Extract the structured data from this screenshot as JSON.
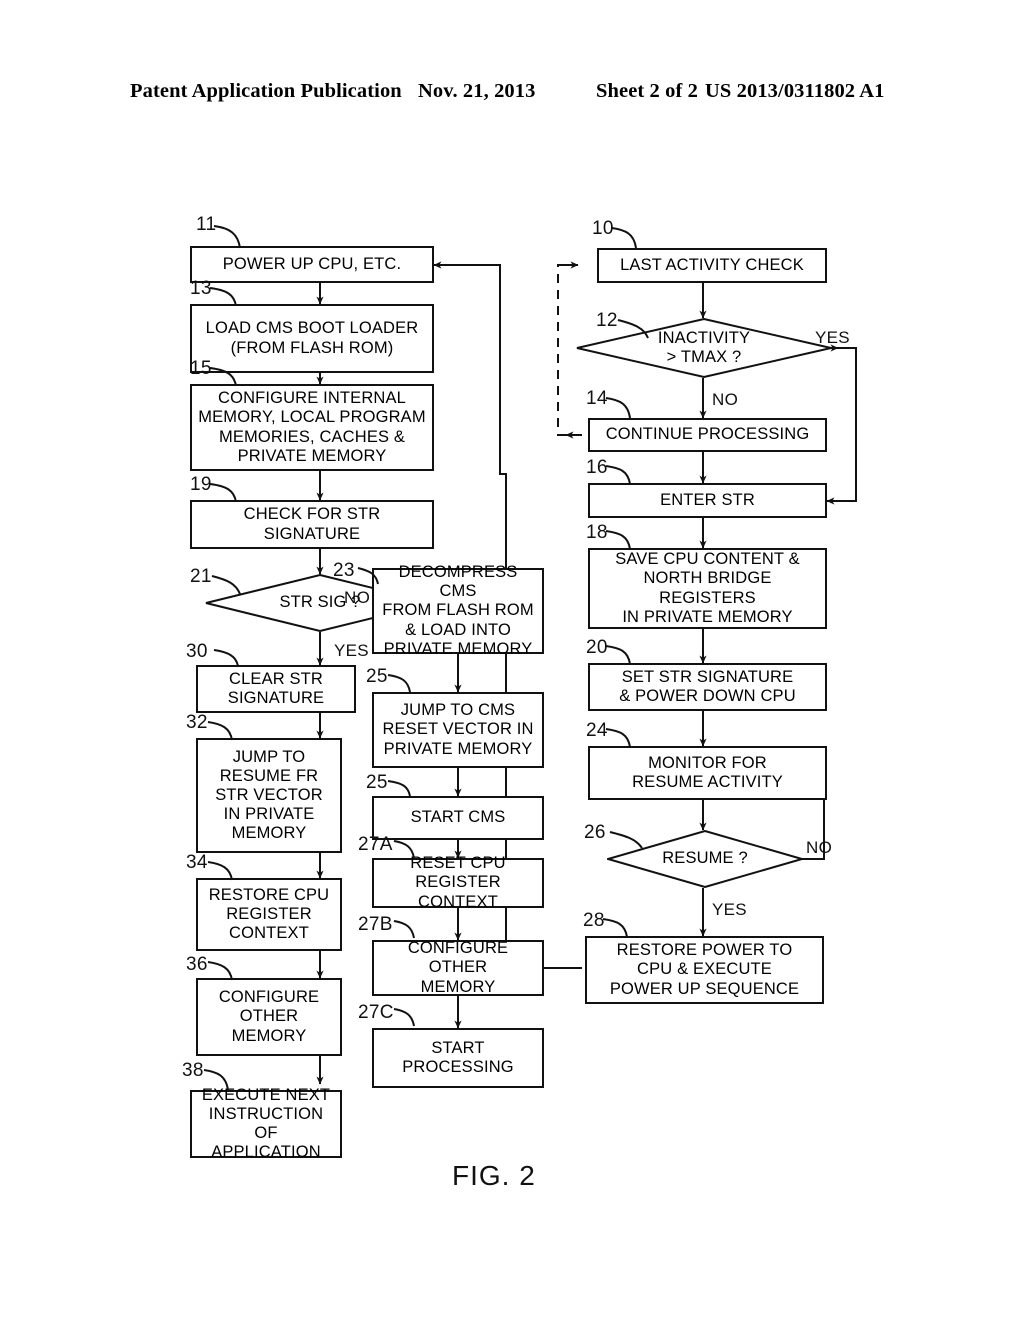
{
  "header": {
    "publication": "Patent Application Publication",
    "date": "Nov. 21, 2013",
    "sheet": "Sheet 2 of 2",
    "number": "US 2013/0311802 A1"
  },
  "figure": {
    "caption": "FIG. 2"
  },
  "chart_data": {
    "type": "diagram",
    "title": "FIG. 2",
    "nodes": [
      {
        "ref": "11",
        "kind": "process",
        "text": "POWER UP CPU, ETC."
      },
      {
        "ref": "13",
        "kind": "process",
        "text": "LOAD CMS BOOT LOADER\n(FROM FLASH ROM)"
      },
      {
        "ref": "15",
        "kind": "process",
        "text": "CONFIGURE INTERNAL\nMEMORY, LOCAL PROGRAM\nMEMORIES, CACHES &\nPRIVATE MEMORY"
      },
      {
        "ref": "19",
        "kind": "process",
        "text": "CHECK FOR STR\nSIGNATURE"
      },
      {
        "ref": "21",
        "kind": "decision",
        "text": "STR SIG ?"
      },
      {
        "ref": "30",
        "kind": "process",
        "text": "CLEAR STR\nSIGNATURE"
      },
      {
        "ref": "32",
        "kind": "process",
        "text": "JUMP TO\nRESUME FR\nSTR VECTOR\nIN PRIVATE\nMEMORY"
      },
      {
        "ref": "34",
        "kind": "process",
        "text": "RESTORE CPU\nREGISTER\nCONTEXT"
      },
      {
        "ref": "36",
        "kind": "process",
        "text": "CONFIGURE\nOTHER\nMEMORY"
      },
      {
        "ref": "38",
        "kind": "process",
        "text": "EXECUTE NEXT\nINSTRUCTION OF\nAPPLICATION"
      },
      {
        "ref": "23",
        "kind": "process",
        "text": "DECOMPRESS CMS\nFROM FLASH ROM\n& LOAD INTO\nPRIVATE MEMORY"
      },
      {
        "ref": "25",
        "kind": "process",
        "text": "JUMP TO CMS\nRESET VECTOR IN\nPRIVATE MEMORY"
      },
      {
        "ref": "25b",
        "kind": "process",
        "text": "START CMS"
      },
      {
        "ref": "27A",
        "kind": "process",
        "text": "RESET CPU\nREGISTER CONTEXT"
      },
      {
        "ref": "27B",
        "kind": "process",
        "text": "CONFIGURE OTHER\nMEMORY"
      },
      {
        "ref": "27C",
        "kind": "process",
        "text": "START\nPROCESSING"
      },
      {
        "ref": "10",
        "kind": "process",
        "text": "LAST ACTIVITY CHECK"
      },
      {
        "ref": "12",
        "kind": "decision",
        "text": "INACTIVITY\n> TMAX ?"
      },
      {
        "ref": "14",
        "kind": "process",
        "text": "CONTINUE PROCESSING"
      },
      {
        "ref": "16",
        "kind": "process",
        "text": "ENTER STR"
      },
      {
        "ref": "18",
        "kind": "process",
        "text": "SAVE CPU CONTENT &\nNORTH BRIDGE REGISTERS\nIN PRIVATE MEMORY"
      },
      {
        "ref": "20",
        "kind": "process",
        "text": "SET STR SIGNATURE\n& POWER DOWN CPU"
      },
      {
        "ref": "24",
        "kind": "process",
        "text": "MONITOR FOR\nRESUME ACTIVITY"
      },
      {
        "ref": "26",
        "kind": "decision",
        "text": "RESUME ?"
      },
      {
        "ref": "28",
        "kind": "process",
        "text": "RESTORE POWER TO\nCPU & EXECUTE\nPOWER UP  SEQUENCE"
      }
    ],
    "branch_labels": [
      {
        "id": "str-sig-no",
        "text": "NO"
      },
      {
        "id": "str-sig-yes",
        "text": "YES"
      },
      {
        "id": "inactivity-yes",
        "text": "YES"
      },
      {
        "id": "inactivity-no",
        "text": "NO"
      },
      {
        "id": "resume-no",
        "text": "NO"
      },
      {
        "id": "resume-yes",
        "text": "YES"
      }
    ],
    "ref_labels": [
      "11",
      "13",
      "15",
      "19",
      "21",
      "30",
      "32",
      "34",
      "36",
      "38",
      "23",
      "25",
      "25",
      "27A",
      "27B",
      "27C",
      "10",
      "12",
      "14",
      "16",
      "18",
      "20",
      "24",
      "26",
      "28"
    ]
  },
  "boxes": {
    "n11": "POWER UP CPU, ETC.",
    "n13": "LOAD CMS BOOT LOADER\n(FROM FLASH ROM)",
    "n15": "CONFIGURE INTERNAL\nMEMORY, LOCAL PROGRAM\nMEMORIES, CACHES &\nPRIVATE MEMORY",
    "n19": "CHECK FOR STR\nSIGNATURE",
    "n21": "STR SIG ?",
    "n30": "CLEAR STR\nSIGNATURE",
    "n32": "JUMP TO\nRESUME FR\nSTR VECTOR\nIN PRIVATE\nMEMORY",
    "n34": "RESTORE CPU\nREGISTER\nCONTEXT",
    "n36": "CONFIGURE\nOTHER\nMEMORY",
    "n38": "EXECUTE NEXT\nINSTRUCTION OF\nAPPLICATION",
    "n23": "DECOMPRESS CMS\nFROM FLASH ROM\n& LOAD INTO\nPRIVATE MEMORY",
    "n25": "JUMP TO CMS\nRESET VECTOR IN\nPRIVATE MEMORY",
    "n25b": "START CMS",
    "n27A": "RESET CPU\nREGISTER CONTEXT",
    "n27B": "CONFIGURE OTHER\nMEMORY",
    "n27C": "START\nPROCESSING",
    "n10": "LAST ACTIVITY CHECK",
    "n12": "INACTIVITY\n> TMAX ?",
    "n14": "CONTINUE PROCESSING",
    "n16": "ENTER STR",
    "n18": "SAVE CPU CONTENT &\nNORTH BRIDGE REGISTERS\nIN PRIVATE MEMORY",
    "n20": "SET STR SIGNATURE\n& POWER DOWN CPU",
    "n24": "MONITOR FOR\nRESUME ACTIVITY",
    "n26": "RESUME ?",
    "n28": "RESTORE POWER TO\nCPU & EXECUTE\nPOWER UP  SEQUENCE"
  },
  "refs": {
    "r11": "11",
    "r13": "13",
    "r15": "15",
    "r19": "19",
    "r21": "21",
    "r30": "30",
    "r32": "32",
    "r34": "34",
    "r36": "36",
    "r38": "38",
    "r23": "23",
    "r25": "25",
    "r25b": "25",
    "r27A": "27A",
    "r27B": "27B",
    "r27C": "27C",
    "r10": "10",
    "r12": "12",
    "r14": "14",
    "r16": "16",
    "r18": "18",
    "r20": "20",
    "r24": "24",
    "r26": "26",
    "r28": "28"
  },
  "labels": {
    "strsig_no": "NO",
    "strsig_yes": "YES",
    "inact_yes": "YES",
    "inact_no": "NO",
    "resume_no": "NO",
    "resume_yes": "YES"
  }
}
